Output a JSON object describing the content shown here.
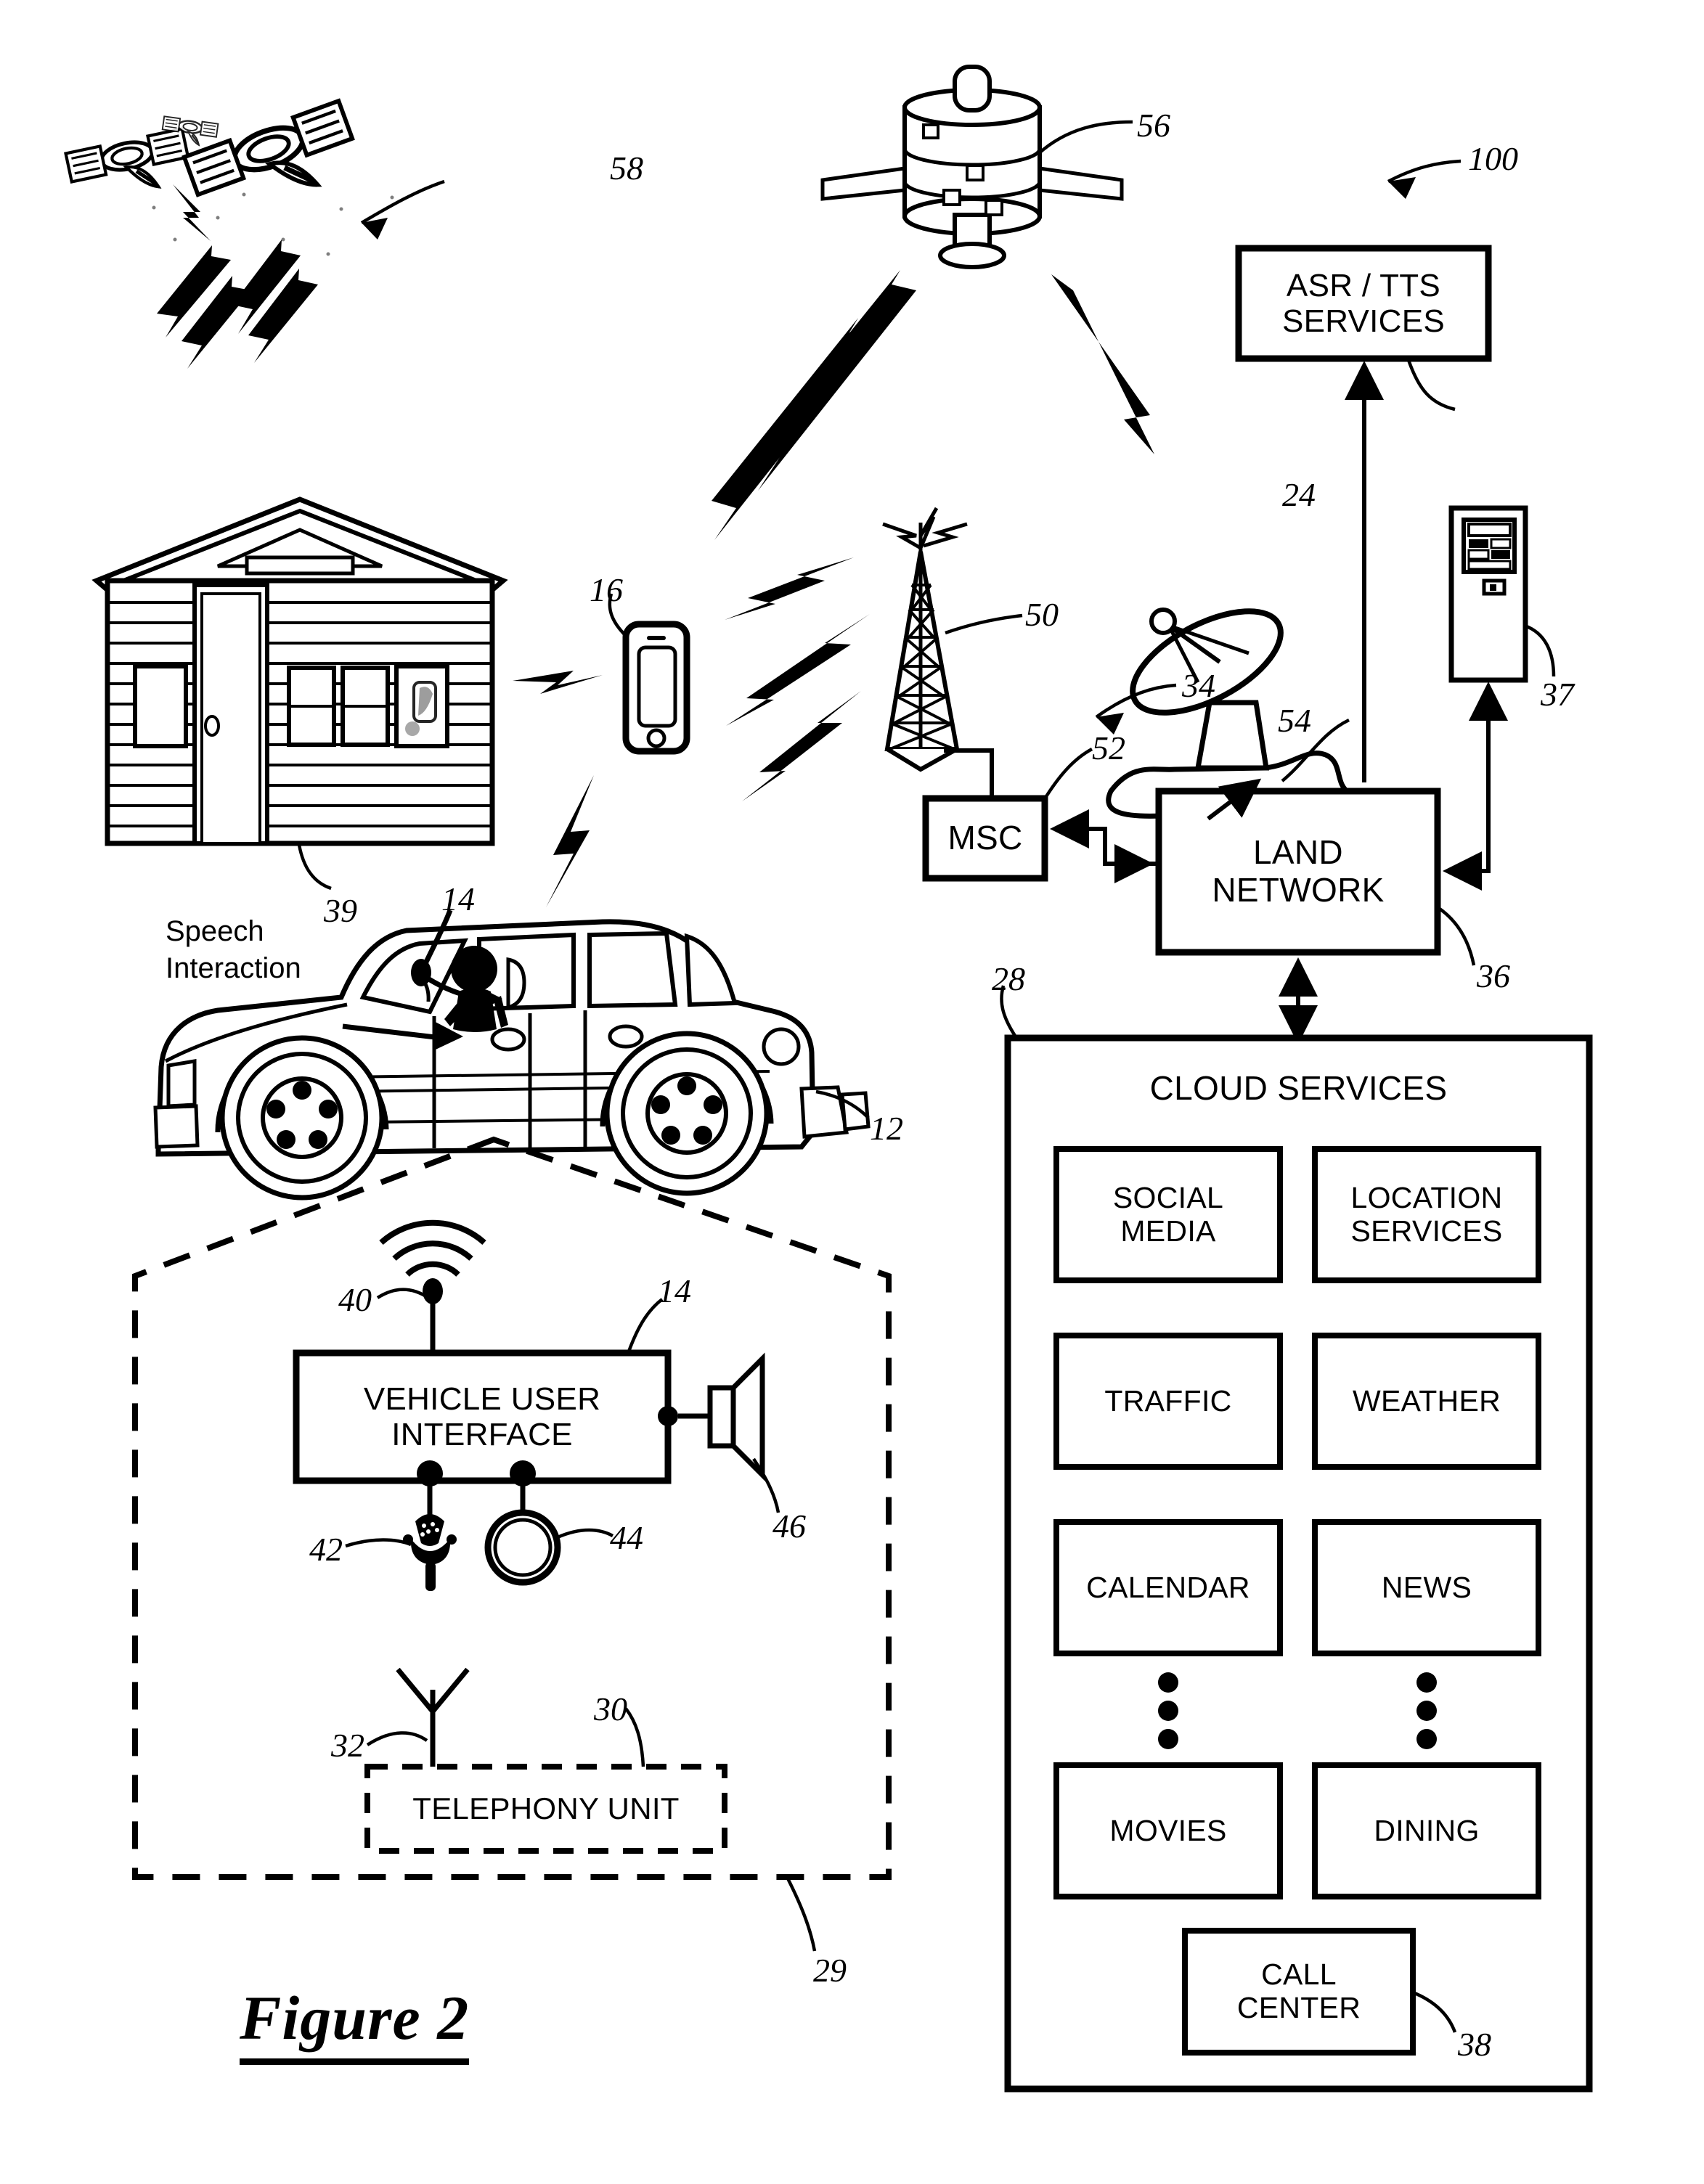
{
  "figure": {
    "title": "Figure 2",
    "system_ref": "100"
  },
  "annotations": {
    "speech_interaction": "Speech\nInteraction"
  },
  "blocks": {
    "asr_tts": {
      "label": "ASR / TTS\nSERVICES",
      "ref": "24"
    },
    "land_network": {
      "label": "LAND\nNETWORK",
      "ref": "36"
    },
    "msc": {
      "label": "MSC",
      "ref": "52"
    },
    "cloud_services": {
      "label": "CLOUD SERVICES",
      "ref": "28"
    },
    "vehicle_user_interface": {
      "label": "VEHICLE USER\nINTERFACE",
      "ref": "14"
    },
    "telephony_unit": {
      "label": "TELEPHONY UNIT",
      "ref": "30"
    }
  },
  "cloud_service_tiles": [
    {
      "label": "SOCIAL\nMEDIA"
    },
    {
      "label": "LOCATION\nSERVICES"
    },
    {
      "label": "TRAFFIC"
    },
    {
      "label": "WEATHER"
    },
    {
      "label": "CALENDAR"
    },
    {
      "label": "NEWS"
    },
    {
      "label": "MOVIES"
    },
    {
      "label": "DINING"
    }
  ],
  "call_center": {
    "label": "CALL\nCENTER",
    "ref": "38"
  },
  "reference_numerals": [
    {
      "id": "100",
      "target": "system-overall"
    },
    {
      "id": "58",
      "target": "gps-satellite-constellation"
    },
    {
      "id": "56",
      "target": "communication-satellite"
    },
    {
      "id": "54",
      "target": "ground-station-dish"
    },
    {
      "id": "24",
      "target": "asr-tts-services-block"
    },
    {
      "id": "37",
      "target": "computer-server"
    },
    {
      "id": "50",
      "target": "cell-tower"
    },
    {
      "id": "52",
      "target": "msc-block"
    },
    {
      "id": "34",
      "target": "wireless-carrier-system"
    },
    {
      "id": "36",
      "target": "land-network-block"
    },
    {
      "id": "28",
      "target": "cloud-services-block"
    },
    {
      "id": "38",
      "target": "call-center-block"
    },
    {
      "id": "16",
      "target": "mobile-phone"
    },
    {
      "id": "39",
      "target": "house"
    },
    {
      "id": "14",
      "target": "vehicle-user-interface"
    },
    {
      "id": "12",
      "target": "vehicle"
    },
    {
      "id": "40",
      "target": "antenna-wireless"
    },
    {
      "id": "46",
      "target": "speaker"
    },
    {
      "id": "42",
      "target": "microphone"
    },
    {
      "id": "44",
      "target": "pushbutton"
    },
    {
      "id": "32",
      "target": "telephony-antenna"
    },
    {
      "id": "30",
      "target": "telephony-unit-block"
    },
    {
      "id": "29",
      "target": "vehicle-electronics-boundary"
    }
  ],
  "icons": {
    "gps_satellites": "satellite-icon",
    "comm_satellite": "satellite-icon",
    "ground_dish": "satellite-dish-icon",
    "computer": "server-tower-icon",
    "cell_tower": "cell-tower-icon",
    "house": "house-icon",
    "mobile_phone": "smartphone-icon",
    "vehicle": "suv-icon",
    "antenna": "wifi-antenna-icon",
    "speaker": "speaker-icon",
    "microphone": "microphone-icon",
    "pushbutton": "circle-button-icon",
    "telephony_antenna": "whip-antenna-icon",
    "lightning": "lightning-bolt-icon",
    "vertical_ellipsis": "vertical-ellipsis-icon"
  },
  "colors": {
    "line": "#000000",
    "background": "#ffffff"
  }
}
